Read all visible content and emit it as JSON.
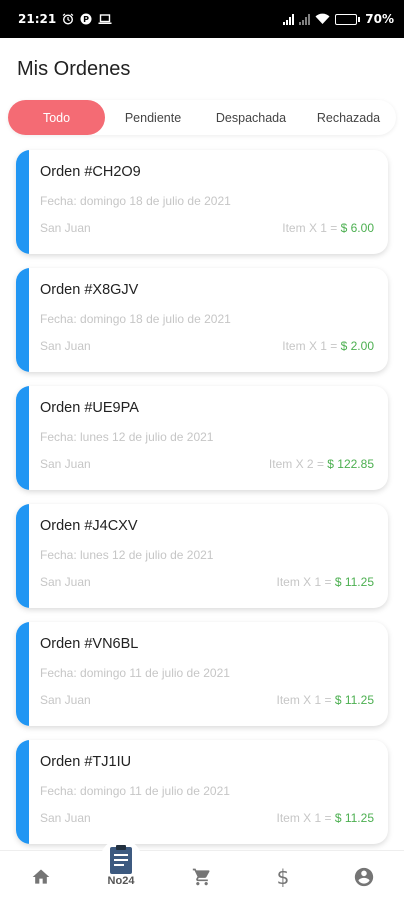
{
  "status_bar": {
    "time": "21:21",
    "battery": "70",
    "battery_fraction": 0.7
  },
  "header": {
    "title": "Mis Ordenes"
  },
  "tabs": [
    {
      "label": "Todo",
      "active": true
    },
    {
      "label": "Pendiente",
      "active": false
    },
    {
      "label": "Despachada",
      "active": false
    },
    {
      "label": "Rechazada",
      "active": false
    }
  ],
  "orders": [
    {
      "title": "Orden #CH2O9",
      "date": "Fecha: domingo 18 de julio de 2021",
      "city": "San Juan",
      "qty": "Item X 1 = ",
      "amount": "$ 6.00"
    },
    {
      "title": "Orden #X8GJV",
      "date": "Fecha: domingo 18 de julio de 2021",
      "city": "San Juan",
      "qty": "Item X 1 = ",
      "amount": "$ 2.00"
    },
    {
      "title": "Orden #UE9PA",
      "date": "Fecha: lunes 12 de julio de 2021",
      "city": "San Juan",
      "qty": "Item X 2 = ",
      "amount": "$ 122.85"
    },
    {
      "title": "Orden #J4CXV",
      "date": "Fecha: lunes 12 de julio de 2021",
      "city": "San Juan",
      "qty": "Item X 1 = ",
      "amount": "$ 11.25"
    },
    {
      "title": "Orden #VN6BL",
      "date": "Fecha: domingo 11 de julio de 2021",
      "city": "San Juan",
      "qty": "Item X 1 = ",
      "amount": "$ 11.25"
    },
    {
      "title": "Orden #TJ1IU",
      "date": "Fecha: domingo 11 de julio de 2021",
      "city": "San Juan",
      "qty": "Item X 1 = ",
      "amount": "$ 11.25"
    }
  ],
  "bottom_nav": {
    "center_label": "No24",
    "icons": [
      "home-icon",
      "orders-icon",
      "cart-icon",
      "dollar-icon",
      "account-icon"
    ]
  },
  "colors": {
    "accent_tab": "#f46b74",
    "card_bar": "#2196f3",
    "price_green": "#4caf50",
    "muted_text": "#c6c6c6"
  }
}
